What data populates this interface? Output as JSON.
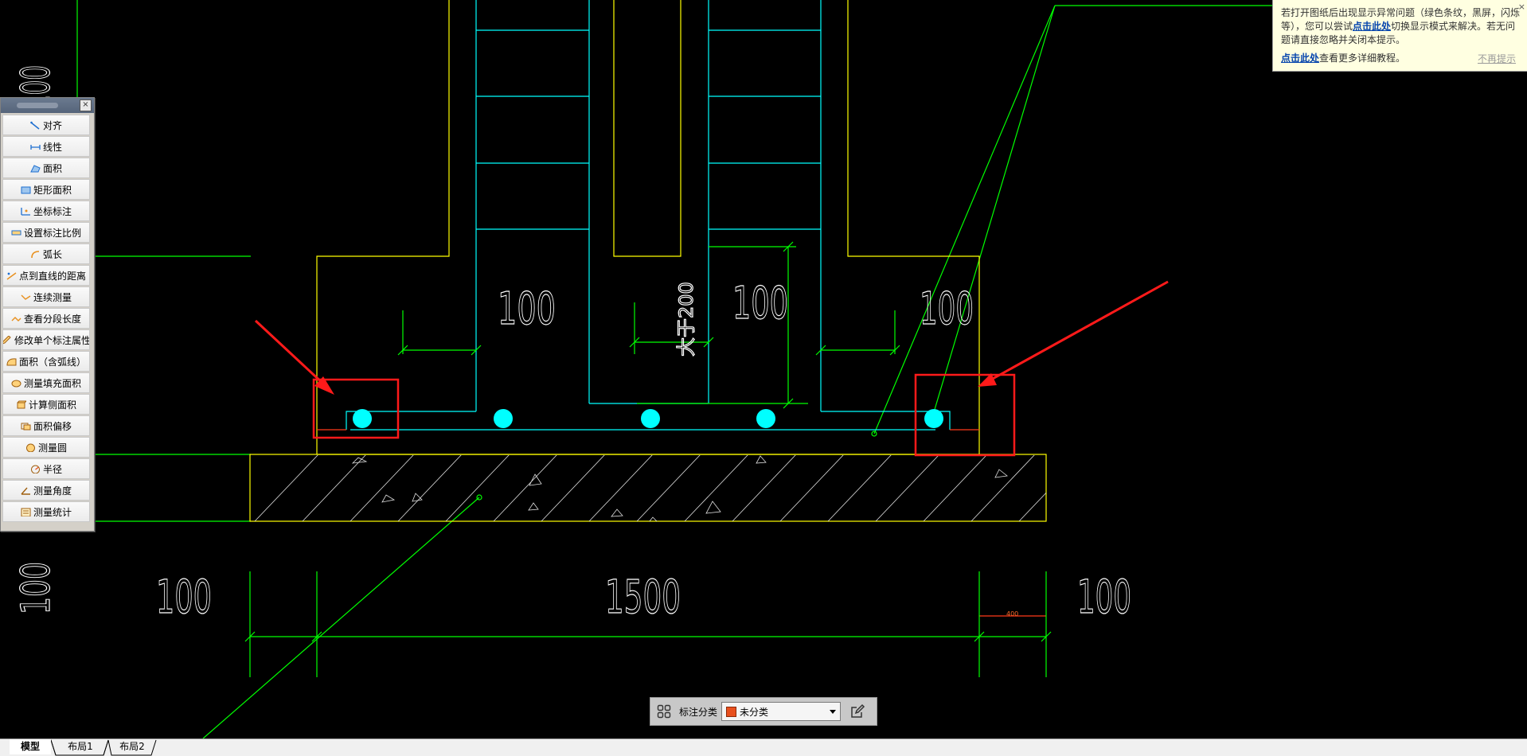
{
  "drawing": {
    "dimensions": {
      "top_left": "100",
      "top_center": "100",
      "top_right": "100",
      "vertical_text": "大于200",
      "bottom_left": "100",
      "bottom_center": "1500",
      "bottom_right": "100",
      "left_vertical_upper": "100",
      "left_vertical_lower": "100",
      "small_right": "400"
    }
  },
  "palette": {
    "items": [
      {
        "label": "对齐",
        "icon": "align-icon"
      },
      {
        "label": "线性",
        "icon": "linear-dim-icon"
      },
      {
        "label": "面积",
        "icon": "area-icon"
      },
      {
        "label": "矩形面积",
        "icon": "rect-area-icon"
      },
      {
        "label": "坐标标注",
        "icon": "coordinate-icon"
      },
      {
        "label": "设置标注比例",
        "icon": "scale-icon"
      },
      {
        "label": "弧长",
        "icon": "arc-length-icon"
      },
      {
        "label": "点到直线的距离",
        "icon": "point-line-icon"
      },
      {
        "label": "连续测量",
        "icon": "continuous-icon"
      },
      {
        "label": "查看分段长度",
        "icon": "segment-icon"
      },
      {
        "label": "修改单个标注属性",
        "icon": "edit-dim-icon"
      },
      {
        "label": "面积（含弧线）",
        "icon": "arc-area-icon"
      },
      {
        "label": "测量填充面积",
        "icon": "fill-area-icon"
      },
      {
        "label": "计算侧面积",
        "icon": "side-area-icon"
      },
      {
        "label": "面积偏移",
        "icon": "area-offset-icon"
      },
      {
        "label": "测量圆",
        "icon": "circle-icon"
      },
      {
        "label": "半径",
        "icon": "radius-icon"
      },
      {
        "label": "测量角度",
        "icon": "angle-icon"
      },
      {
        "label": "测量统计",
        "icon": "stats-icon"
      }
    ]
  },
  "notice": {
    "text_a": "若打开图纸后出现显示异常问题（绿色条纹，黑屏，闪烁等），您可以尝试",
    "link1": "点击此处",
    "text_b": "切换显示模式来解决。若无问题请直接忽略并关闭本提示。",
    "link2": "点击此处",
    "text_c": "查看更多详细教程。",
    "dismiss": "不再提示",
    "close": "×"
  },
  "category_bar": {
    "label": "标注分类",
    "value": "未分类",
    "swatch_color": "#e8501e"
  },
  "tabs": [
    {
      "label": "模型",
      "active": true
    },
    {
      "label": "布局1",
      "active": false
    },
    {
      "label": "布局2",
      "active": false
    }
  ],
  "colors": {
    "cyan": "#00ffff",
    "green": "#00ff00",
    "yellow": "#ffff00",
    "red": "#ff0000",
    "white": "#ffffff",
    "red_arrow": "#ff1a1a"
  }
}
